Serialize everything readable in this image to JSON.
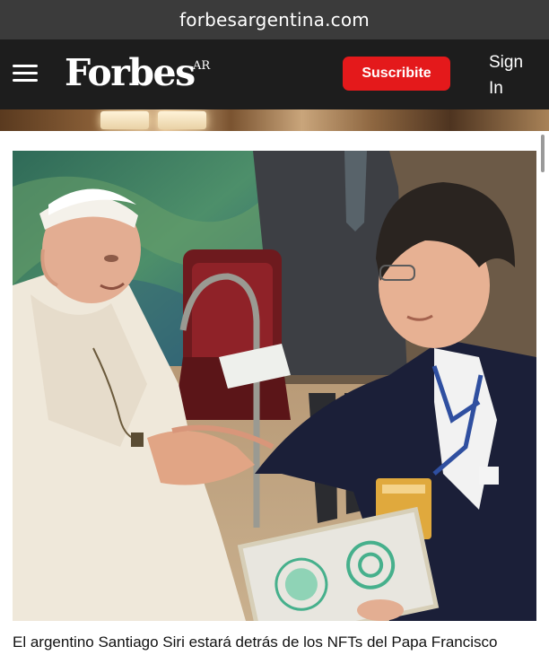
{
  "browser": {
    "url": "forbesargentina.com"
  },
  "header": {
    "logo": "Forbes",
    "edition": "AR",
    "subscribe_label": "Suscribite",
    "signin_label": "Sign In"
  },
  "article": {
    "image_icon": "photo-pope-handshake",
    "caption": "El argentino Santiago Siri estará detrás de los NFTs del Papa Francisco"
  },
  "colors": {
    "brand_bar": "#1d1d1d",
    "subscribe": "#e4191b",
    "url_bar": "#3b3b3b"
  }
}
